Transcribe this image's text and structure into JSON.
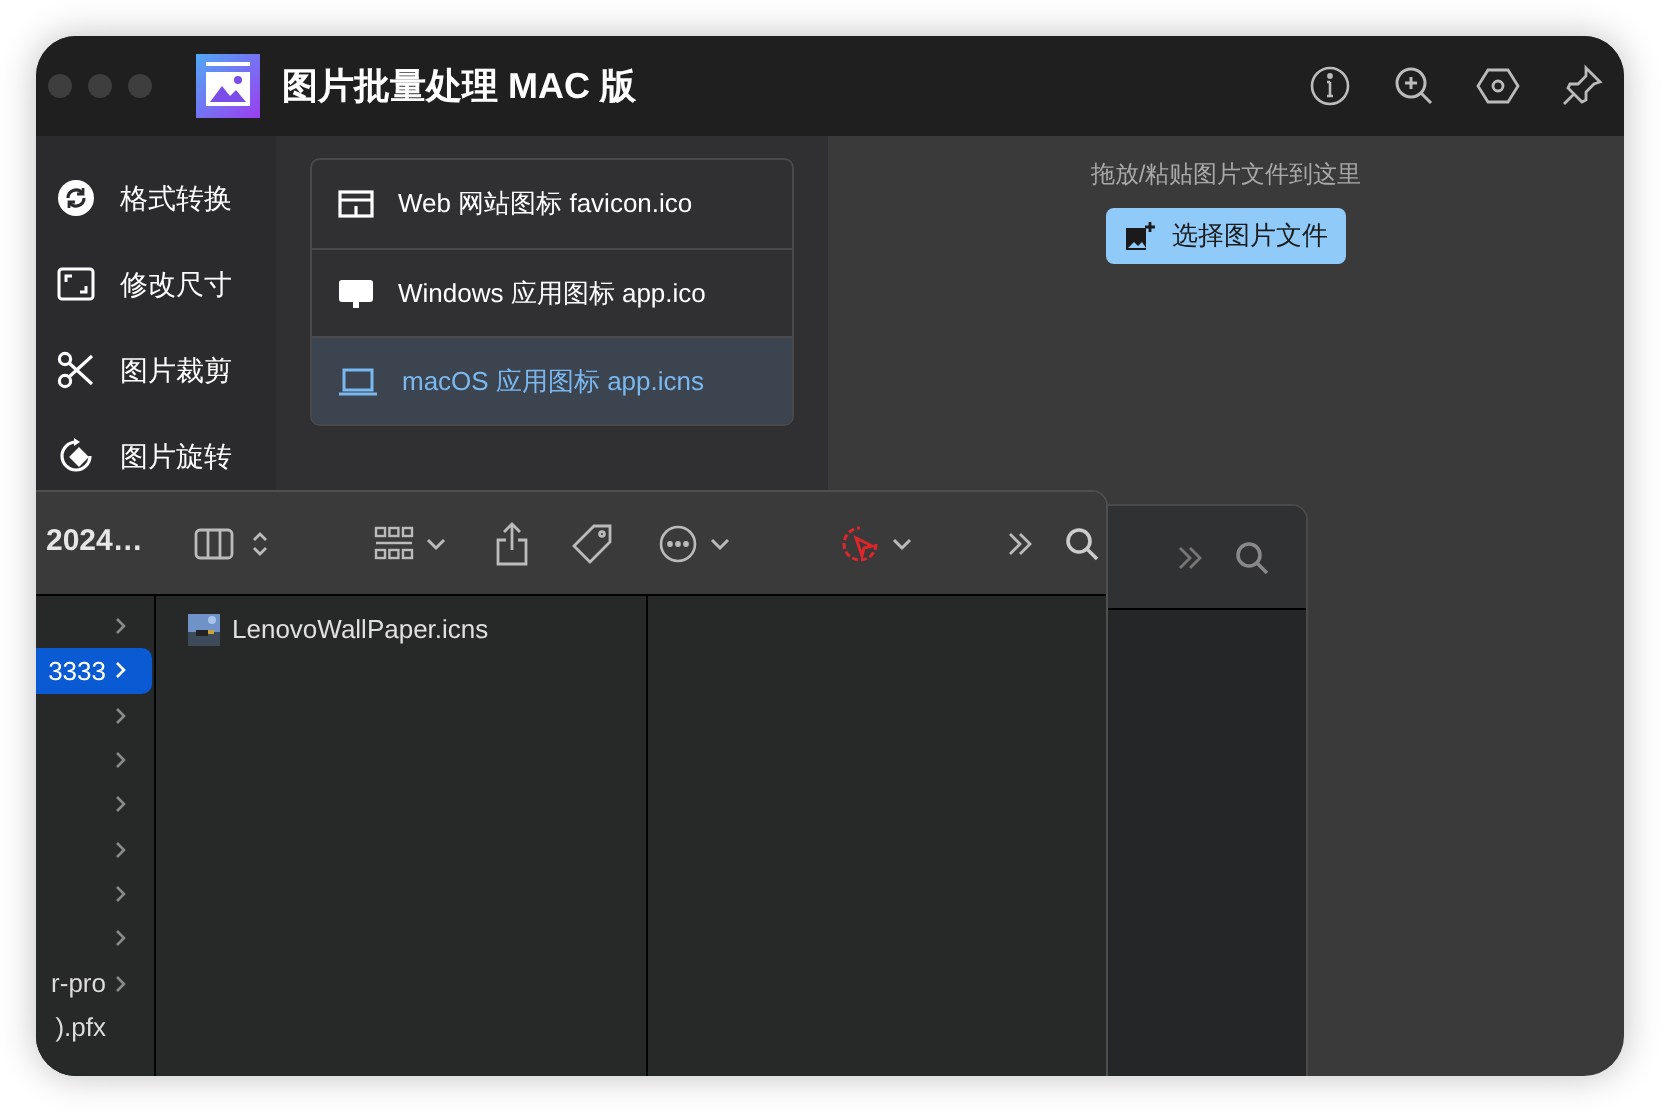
{
  "window": {
    "title": "图片批量处理 MAC 版"
  },
  "sidebar": {
    "items": [
      {
        "label": "格式转换",
        "selected": false
      },
      {
        "label": "修改尺寸",
        "selected": false
      },
      {
        "label": "图片裁剪",
        "selected": false
      },
      {
        "label": "图片旋转",
        "selected": false
      }
    ]
  },
  "options": [
    {
      "label": "Web 网站图标 favicon.ico",
      "selected": false
    },
    {
      "label": "Windows 应用图标 app.ico",
      "selected": false
    },
    {
      "label": "macOS 应用图标 app.icns",
      "selected": true
    }
  ],
  "drop_zone": {
    "hint": "拖放/粘贴图片文件到这里",
    "button": "选择图片文件"
  },
  "finder": {
    "title": "2024…",
    "folders": [
      {
        "folder": true,
        "selected": false
      },
      {
        "label": "3333",
        "folder": true,
        "selected": true
      },
      {
        "folder": true,
        "selected": false
      },
      {
        "folder": true,
        "selected": false
      },
      {
        "folder": true,
        "selected": false
      },
      {
        "folder": true,
        "selected": false
      },
      {
        "folder": true,
        "selected": false
      },
      {
        "folder": true,
        "selected": false
      },
      {
        "label": "r-pro",
        "folder": true,
        "selected": false
      },
      {
        "label": ").pfx",
        "folder": false,
        "selected": false
      }
    ],
    "files": [
      {
        "name": "LenovoWallPaper.icns",
        "selected": false
      }
    ]
  }
}
